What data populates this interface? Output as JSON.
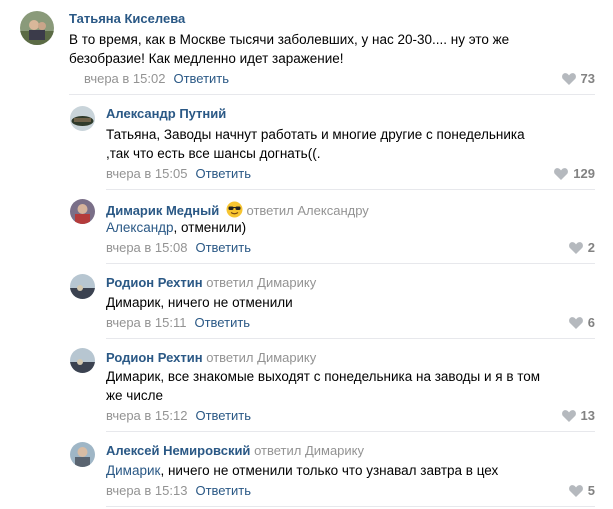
{
  "comments": [
    {
      "author": "Татьяна Киселева",
      "text_lines": [
        "В то время, как в Москве тысячи заболевших, у нас 20-30.... ну это же",
        "безобразие! Как медленно идет заражение!"
      ],
      "date": "вчера в 15:02",
      "reply_label": "Ответить",
      "likes": "73"
    },
    {
      "author": "Александр Путний",
      "text_lines": [
        "Татьяна, Заводы начнут работать и многие другие с понедельника",
        ",так что есть все шансы догнать((."
      ],
      "date": "вчера в 15:05",
      "reply_label": "Ответить",
      "likes": "129"
    },
    {
      "author": "Димарик Медный",
      "replied_label": "ответил",
      "replied_to": "Александру",
      "mention": "Александр",
      "text_rest": ", отменили)",
      "date": "вчера в 15:08",
      "reply_label": "Ответить",
      "likes": "2"
    },
    {
      "author": "Родион Рехтин",
      "replied_label": "ответил",
      "replied_to": "Димарику",
      "text_lines": [
        "Димарик, ничего не отменили"
      ],
      "date": "вчера в 15:11",
      "reply_label": "Ответить",
      "likes": "6"
    },
    {
      "author": "Родион Рехтин",
      "replied_label": "ответил",
      "replied_to": "Димарику",
      "text_lines": [
        "Димарик, все знакомые выходят с понедельника на заводы и я в том",
        "же числе"
      ],
      "date": "вчера в 15:12",
      "reply_label": "Ответить",
      "likes": "13"
    },
    {
      "author": "Алексей Немировский",
      "replied_label": "ответил",
      "replied_to": "Димарику",
      "mention": "Димарик",
      "text_rest": ", ничего не отменили только что узнавал завтра в цех",
      "date": "вчера в 15:13",
      "reply_label": "Ответить",
      "likes": "5"
    }
  ],
  "colors": {
    "author": "#2a5885",
    "meta": "#939393",
    "likes": "#828282",
    "divider": "#e7e8ec"
  },
  "icons": {
    "like": "heart-icon",
    "emoji": "sunglasses-emoji-icon"
  }
}
